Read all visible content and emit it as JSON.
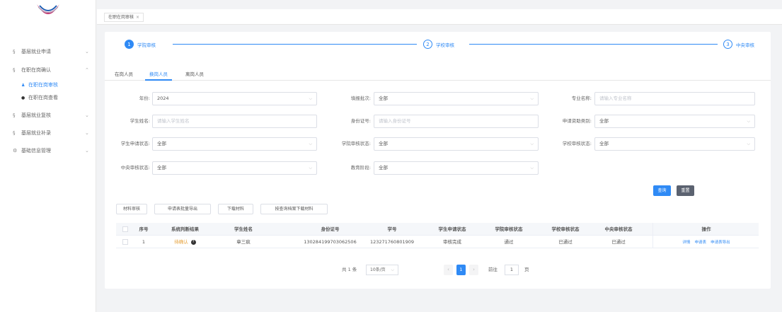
{
  "sidebar": {
    "items": [
      {
        "icon": "grid-icon",
        "label": "基层就业申请"
      },
      {
        "icon": "grid-icon",
        "label": "在职在岗确认"
      },
      {
        "icon": "grid-icon",
        "label": "基层就业复核"
      },
      {
        "icon": "grid-icon",
        "label": "基层就业补录"
      },
      {
        "icon": "gear-icon",
        "label": "基础信息管理"
      }
    ],
    "sub_items": [
      {
        "label": "在职在岗审核"
      },
      {
        "label": "在职在岗查看"
      }
    ]
  },
  "tabbar": {
    "tab_label": "在职在岗审核",
    "close": "×"
  },
  "steps": [
    {
      "num": "1",
      "label": "学院审核"
    },
    {
      "num": "2",
      "label": "学校审核"
    },
    {
      "num": "3",
      "label": "中央审核"
    }
  ],
  "inner_tabs": [
    "在岗人员",
    "换岗人员",
    "离岗人员"
  ],
  "filters": {
    "year_label": "年份:",
    "year_value": "2024",
    "batch_label": "填报批次:",
    "batch_value": "全部",
    "major_label": "专业名称:",
    "major_placeholder": "请输入专业名称",
    "name_label": "学生姓名:",
    "name_placeholder": "请输入学生姓名",
    "id_label": "身份证号:",
    "id_placeholder": "请输入身份证号",
    "aid_label": "申请资助类别:",
    "aid_value": "全部",
    "apply_status_label": "学生申请状态:",
    "apply_status_value": "全部",
    "college_status_label": "学院审核状态:",
    "college_status_value": "全部",
    "school_status_label": "学校审核状态:",
    "school_status_value": "全部",
    "central_status_label": "中央审核状态:",
    "central_status_value": "全部",
    "edu_label": "教育阶段:",
    "edu_value": "全部",
    "caret": "⌵"
  },
  "buttons": {
    "query": "查询",
    "reset": "重置",
    "material_review": "材料审核",
    "export": "申请表批量导出",
    "download": "下载材料",
    "download_by_file": "按查询档案下载材料"
  },
  "table": {
    "headers": [
      "序号",
      "系统判断结果",
      "学生姓名",
      "身份证号",
      "学号",
      "学生申请状态",
      "学院审核状态",
      "学校审核状态",
      "中央审核状态",
      "操作"
    ],
    "rows": [
      {
        "no": "1",
        "result": "待确认",
        "name": "章三疯",
        "id": "130284199703062506",
        "student_no": "123271760801909",
        "apply_status": "审核完成",
        "college_status": "通过",
        "school_status": "已通过",
        "central_status": "已通过",
        "ops": [
          "详情",
          "申请表",
          "申请表导出"
        ]
      }
    ]
  },
  "pagination": {
    "total": "共 1 条",
    "page_size": "10条/页",
    "prev": "‹",
    "current": "1",
    "next": "›",
    "goto": "前往",
    "goto_value": "1",
    "page_unit": "页"
  },
  "colors": {
    "accent": "#2f8af5",
    "pending": "#e6a23c",
    "dark_button": "#5b6270"
  }
}
